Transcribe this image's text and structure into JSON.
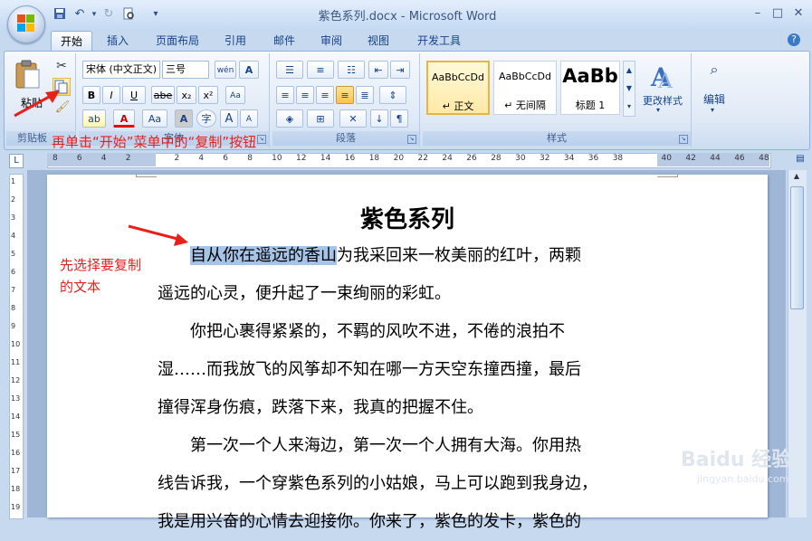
{
  "window": {
    "title": "紫色系列.docx - Microsoft Word",
    "minimize": "–",
    "maximize": "□",
    "close": "✕"
  },
  "quick_access": {
    "save_icon": "save-icon",
    "undo_icon": "undo-icon",
    "redo_icon": "redo-icon",
    "print_preview_icon": "print-preview-icon",
    "customize_icon": "dropdown-icon"
  },
  "tabs": [
    {
      "label": "开始",
      "active": true
    },
    {
      "label": "插入"
    },
    {
      "label": "页面布局"
    },
    {
      "label": "引用"
    },
    {
      "label": "邮件"
    },
    {
      "label": "审阅"
    },
    {
      "label": "视图"
    },
    {
      "label": "开发工具"
    }
  ],
  "ribbon": {
    "clipboard": {
      "paste_label": "粘贴",
      "group_label": "剪贴板"
    },
    "font": {
      "font_name": "宋体 (中文正文)",
      "font_size": "三号",
      "wen_label": "wén",
      "A_label": "A",
      "bold": "B",
      "italic": "I",
      "underline": "U",
      "strike": "abe",
      "sub": "x₂",
      "sup": "x²",
      "clear": "Aa",
      "highlight": "ab",
      "font_color": "A",
      "change_case": "Aa",
      "char_shade": "A",
      "enclose": "字",
      "grow": "A",
      "shrink": "A",
      "group_label": "字体"
    },
    "paragraph": {
      "group_label": "段落"
    },
    "styles": {
      "items": [
        {
          "sample": "AaBbCcDd",
          "name": "↵ 正文"
        },
        {
          "sample": "AaBbCcDd",
          "name": "↵ 无间隔"
        },
        {
          "sample": "AaBb",
          "name": "标题 1"
        }
      ],
      "change_styles": "更改样式",
      "group_label": "样式"
    },
    "editing": {
      "label": "编辑"
    }
  },
  "ruler": {
    "h_numbers": [
      "8",
      "6",
      "4",
      "2",
      "",
      "2",
      "4",
      "6",
      "8",
      "10",
      "12",
      "14",
      "16",
      "18",
      "20",
      "22",
      "24",
      "26",
      "28",
      "30",
      "32",
      "34",
      "36",
      "38",
      "",
      "40",
      "42",
      "44",
      "46",
      "48"
    ],
    "v_numbers": [
      "1",
      "2",
      "3",
      "4",
      "5",
      "6",
      "7",
      "8",
      "9",
      "10",
      "11",
      "12",
      "13",
      "14",
      "15",
      "16",
      "17",
      "18",
      "19"
    ]
  },
  "document": {
    "title": "紫色系列",
    "selected_text": "自从你在遥远的香山",
    "lines": [
      "为我采回来一枚美丽的红叶，两颗",
      "遥远的心灵，便升起了一束绚丽的彩虹。",
      "你把心裹得紧紧的，不羁的风吹不进，不倦的浪拍不",
      "湿……而我放飞的风筝却不知在哪一方天空东撞西撞，最后",
      "撞得浑身伤痕，跌落下来，我真的把握不住。",
      "第一次一个人来海边，第一次一个人拥有大海。你用热",
      "线告诉我，一个穿紫色系列的小姑娘，马上可以跑到我身边，",
      "我是用兴奋的心情去迎接你。你来了，紫色的发卡，紫色的"
    ]
  },
  "annotations": {
    "copy_hint": "再单击“开始”菜单中的“复制”按钮",
    "select_hint_1": "先选择要复制",
    "select_hint_2": "的文本",
    "color": "#e8201c"
  },
  "watermark": {
    "brand": "Baidu 经验",
    "url": "jingyan.baidu.com"
  }
}
